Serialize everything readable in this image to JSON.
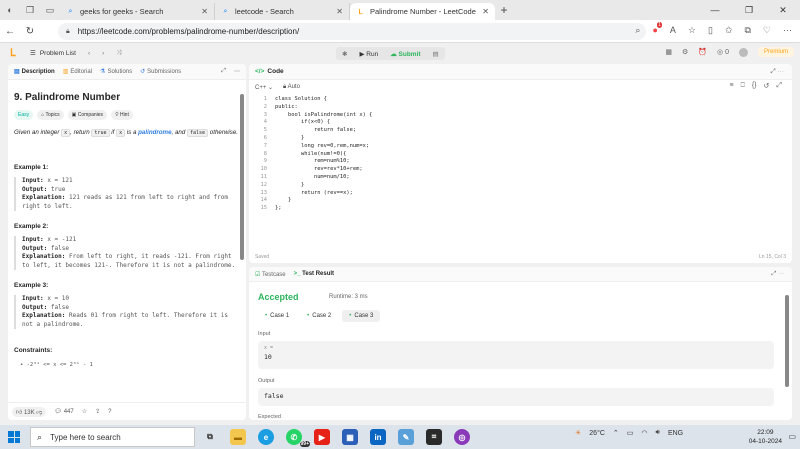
{
  "browser": {
    "tabs": [
      {
        "title": "geeks for geeks - Search",
        "active": false
      },
      {
        "title": "leetcode - Search",
        "active": false
      },
      {
        "title": "Palindrome Number - LeetCode",
        "active": true
      }
    ],
    "url": "https://leetcode.com/problems/palindrome-number/description/",
    "extension_badge": "1"
  },
  "lc_nav": {
    "problem_list": "Problem List",
    "run": "Run",
    "submit": "Submit",
    "coins": "0",
    "premium": "Premium"
  },
  "left": {
    "tabs": [
      "Description",
      "Editorial",
      "Solutions",
      "Submissions"
    ],
    "title": "9. Palindrome Number",
    "badges": [
      "Easy",
      "Topics",
      "Companies",
      "Hint"
    ],
    "desc": {
      "p1": "Given an integer ",
      "x1": "x",
      "p2": ", return ",
      "true": "true",
      "p3": " if ",
      "x2": "x",
      "p4": " is a ",
      "pal": "palindrome",
      "p5": ", and ",
      "false": "false",
      "p6": " otherwise."
    },
    "examples": [
      {
        "heading": "Example 1:",
        "input_label": "Input:",
        "input": "x = 121",
        "output_label": "Output:",
        "output": "true",
        "explanation_label": "Explanation:",
        "explanation": "121 reads as 121 from left to right and from right to left."
      },
      {
        "heading": "Example 2:",
        "input_label": "Input:",
        "input": "x = -121",
        "output_label": "Output:",
        "output": "false",
        "explanation_label": "Explanation:",
        "explanation": "From left to right, it reads -121. From right to left, it becomes 121-. Therefore it is not a palindrome."
      },
      {
        "heading": "Example 3:",
        "input_label": "Input:",
        "input": "x = 10",
        "output_label": "Output:",
        "output": "false",
        "explanation_label": "Explanation:",
        "explanation": "Reads 01 from right to left. Therefore it is not a palindrome."
      }
    ],
    "constraints_heading": "Constraints:",
    "constraint": "-2³¹ <= x <= 2³¹ - 1",
    "footer": {
      "likes": "13K",
      "comments": "447"
    }
  },
  "code": {
    "header": "Code",
    "language": "C++",
    "mode": "Auto",
    "lines": [
      "class Solution {",
      "public:",
      "    bool isPalindrome(int x) {",
      "        if(x<0) {",
      "            return false;",
      "        }",
      "        long rev=0,rem,num=x;",
      "        while(num!=0){",
      "            rem=num%10;",
      "            rev=rev*10+rem;",
      "            num=num/10;",
      "        }",
      "        return (rev==x);",
      "    }",
      "};"
    ],
    "saved": "Saved",
    "cursor": "Ln 15, Col 3"
  },
  "result": {
    "tabs": [
      "Testcase",
      "Test Result"
    ],
    "status": "Accepted",
    "runtime": "Runtime: 3 ms",
    "cases": [
      "Case 1",
      "Case 2",
      "Case 3"
    ],
    "input_label": "Input",
    "input_var": "x =",
    "input_value": "10",
    "output_label": "Output",
    "output_value": "false",
    "expected_label": "Expected"
  },
  "taskbar": {
    "search": "Type here to search",
    "badge": "99+",
    "weather": "26°C",
    "lang": "ENG",
    "time": "22:09",
    "date": "04-10-2024"
  }
}
